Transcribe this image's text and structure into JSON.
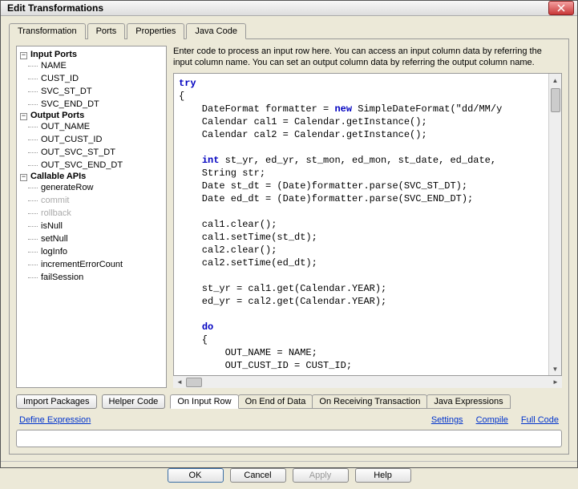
{
  "window": {
    "title": "Edit Transformations"
  },
  "tabs": {
    "transformation": "Transformation",
    "ports": "Ports",
    "properties": "Properties",
    "javacode": "Java Code"
  },
  "tree": {
    "inputPorts": {
      "label": "Input Ports",
      "items": [
        "NAME",
        "CUST_ID",
        "SVC_ST_DT",
        "SVC_END_DT"
      ]
    },
    "outputPorts": {
      "label": "Output Ports",
      "items": [
        "OUT_NAME",
        "OUT_CUST_ID",
        "OUT_SVC_ST_DT",
        "OUT_SVC_END_DT"
      ]
    },
    "callableApis": {
      "label": "Callable APIs",
      "items": [
        "generateRow",
        "commit",
        "rollback",
        "isNull",
        "setNull",
        "logInfo",
        "incrementErrorCount",
        "failSession"
      ]
    }
  },
  "hint": "Enter code to process an input row here. You can access an input column data by referring the input column name. You can set an output column data by referring the output column name.",
  "code": {
    "l1a": "try",
    "l2": "{",
    "l3a": "    DateFormat formatter = ",
    "l3b": "new",
    "l3c": " SimpleDateFormat(\"dd/MM/y",
    "l4": "    Calendar cal1 = Calendar.getInstance();",
    "l5": "    Calendar cal2 = Calendar.getInstance();",
    "l6": "",
    "l7a": "    ",
    "l7b": "int",
    "l7c": " st_yr, ed_yr, st_mon, ed_mon, st_date, ed_date,",
    "l8": "    String str;",
    "l9": "    Date st_dt = (Date)formatter.parse(SVC_ST_DT);",
    "l10": "    Date ed_dt = (Date)formatter.parse(SVC_END_DT);",
    "l11": "",
    "l12": "    cal1.clear();",
    "l13": "    cal1.setTime(st_dt);",
    "l14": "    cal2.clear();",
    "l15": "    cal2.setTime(ed_dt);",
    "l16": "",
    "l17": "    st_yr = cal1.get(Calendar.YEAR);",
    "l18": "    ed_yr = cal2.get(Calendar.YEAR);",
    "l19": "",
    "l20a": "    ",
    "l20b": "do",
    "l21": "    {",
    "l22": "        OUT_NAME = NAME;",
    "l23": "        OUT_CUST_ID = CUST_ID;"
  },
  "buttons": {
    "importPackages": "Import Packages",
    "helperCode": "Helper Code"
  },
  "subtabs": {
    "onInputRow": "On Input Row",
    "onEndOfData": "On End of Data",
    "onReceiving": "On Receiving Transaction",
    "javaExpr": "Java Expressions"
  },
  "links": {
    "defineExpr": "Define Expression",
    "settings": "Settings",
    "compile": "Compile",
    "fullCode": "Full Code"
  },
  "footer": {
    "ok": "OK",
    "cancel": "Cancel",
    "apply": "Apply",
    "help": "Help"
  }
}
